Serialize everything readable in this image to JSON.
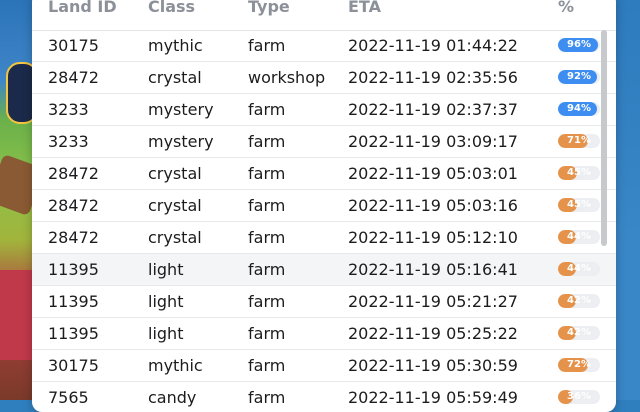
{
  "colors": {
    "high": "#3d8ef0",
    "mid": "#e5924b",
    "track": "#eceef2"
  },
  "table": {
    "headers": [
      "Land ID",
      "Class",
      "Type",
      "ETA",
      "%"
    ],
    "rows": [
      {
        "id": "30175",
        "cls": "mythic",
        "type": "farm",
        "eta": "2022-11-19 01:44:22",
        "pct": 96
      },
      {
        "id": "28472",
        "cls": "crystal",
        "type": "workshop",
        "eta": "2022-11-19 02:35:56",
        "pct": 92
      },
      {
        "id": "3233",
        "cls": "mystery",
        "type": "farm",
        "eta": "2022-11-19 02:37:37",
        "pct": 94
      },
      {
        "id": "3233",
        "cls": "mystery",
        "type": "farm",
        "eta": "2022-11-19 03:09:17",
        "pct": 71
      },
      {
        "id": "28472",
        "cls": "crystal",
        "type": "farm",
        "eta": "2022-11-19 05:03:01",
        "pct": 45
      },
      {
        "id": "28472",
        "cls": "crystal",
        "type": "farm",
        "eta": "2022-11-19 05:03:16",
        "pct": 45
      },
      {
        "id": "28472",
        "cls": "crystal",
        "type": "farm",
        "eta": "2022-11-19 05:12:10",
        "pct": 44
      },
      {
        "id": "11395",
        "cls": "light",
        "type": "farm",
        "eta": "2022-11-19 05:16:41",
        "pct": 44
      },
      {
        "id": "11395",
        "cls": "light",
        "type": "farm",
        "eta": "2022-11-19 05:21:27",
        "pct": 42
      },
      {
        "id": "11395",
        "cls": "light",
        "type": "farm",
        "eta": "2022-11-19 05:25:22",
        "pct": 42
      },
      {
        "id": "30175",
        "cls": "mythic",
        "type": "farm",
        "eta": "2022-11-19 05:30:59",
        "pct": 72
      },
      {
        "id": "7565",
        "cls": "candy",
        "type": "farm",
        "eta": "2022-11-19 05:59:49",
        "pct": 36
      }
    ]
  }
}
